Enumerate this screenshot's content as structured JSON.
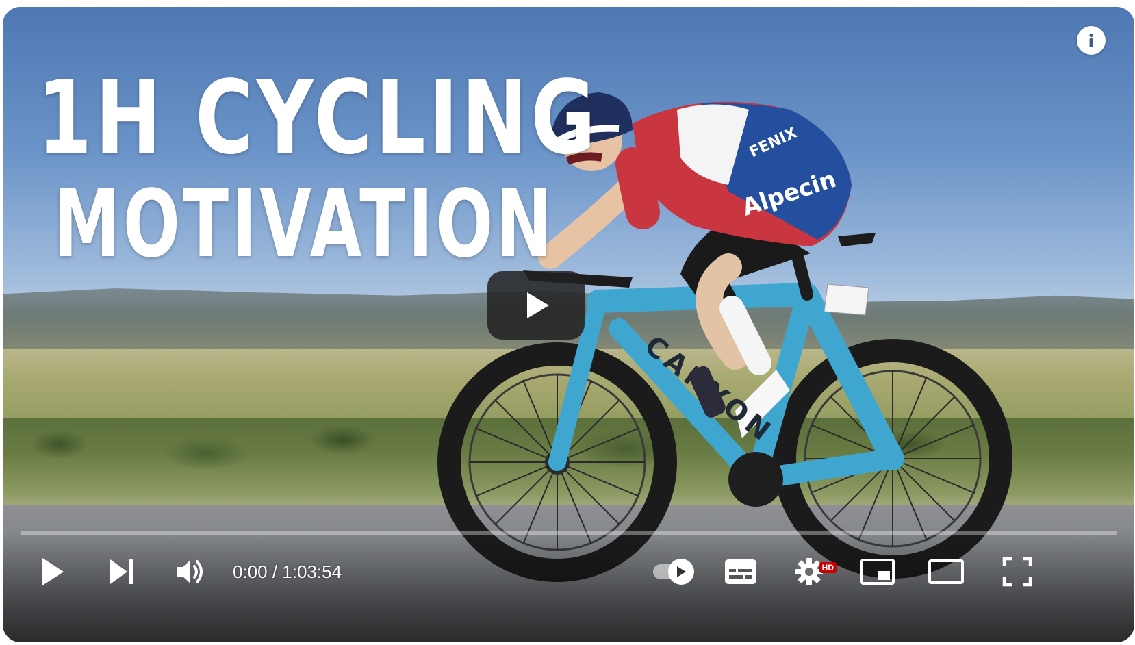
{
  "thumbnail": {
    "title_line1": "1H CYCLING",
    "title_line2": "MOTIVATION"
  },
  "player": {
    "progress_fraction": 0.0,
    "time_current": "0:00",
    "time_separator": " / ",
    "time_total": "1:03:54",
    "hd_badge": "HD",
    "accent_color": "#ff0000",
    "badge_color": "#cc0000"
  },
  "controls": {
    "icons": [
      "play-icon",
      "next-icon",
      "volume-icon",
      "autoplay-toggle-icon",
      "subtitles-icon",
      "settings-gear-icon",
      "miniplayer-icon",
      "theater-mode-icon",
      "fullscreen-icon",
      "info-icon",
      "large-play-icon"
    ]
  }
}
